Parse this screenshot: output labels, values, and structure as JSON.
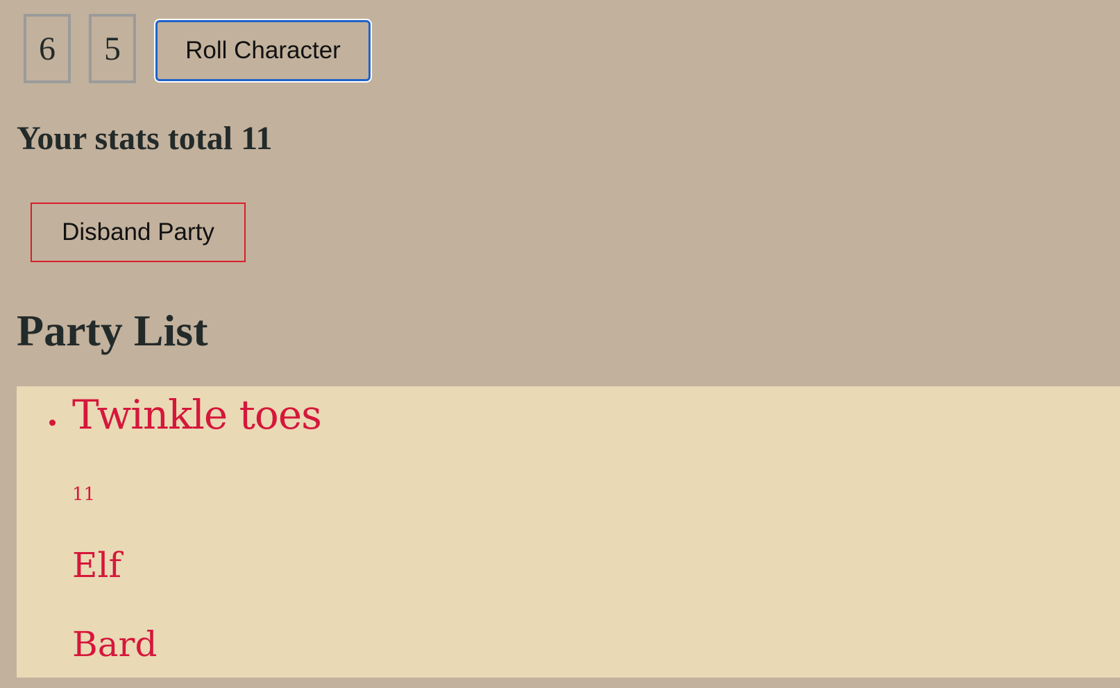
{
  "dice": [
    {
      "value": "6"
    },
    {
      "value": "5"
    }
  ],
  "controls": {
    "roll_label": "Roll Character",
    "disband_label": "Disband Party"
  },
  "stats": {
    "total_text": "Your stats total 11"
  },
  "party": {
    "heading": "Party List",
    "members": [
      {
        "name": "Twinkle toes",
        "stat_total": "11",
        "race": "Elf",
        "class": "Bard"
      }
    ]
  },
  "colors": {
    "background": "#c2b19c",
    "list_background": "#e9d9b5",
    "member_text": "#d5173b",
    "roll_button_border": "#1f63c9",
    "disband_button_border": "#d91d2a",
    "die_border": "#9b9b9b"
  }
}
